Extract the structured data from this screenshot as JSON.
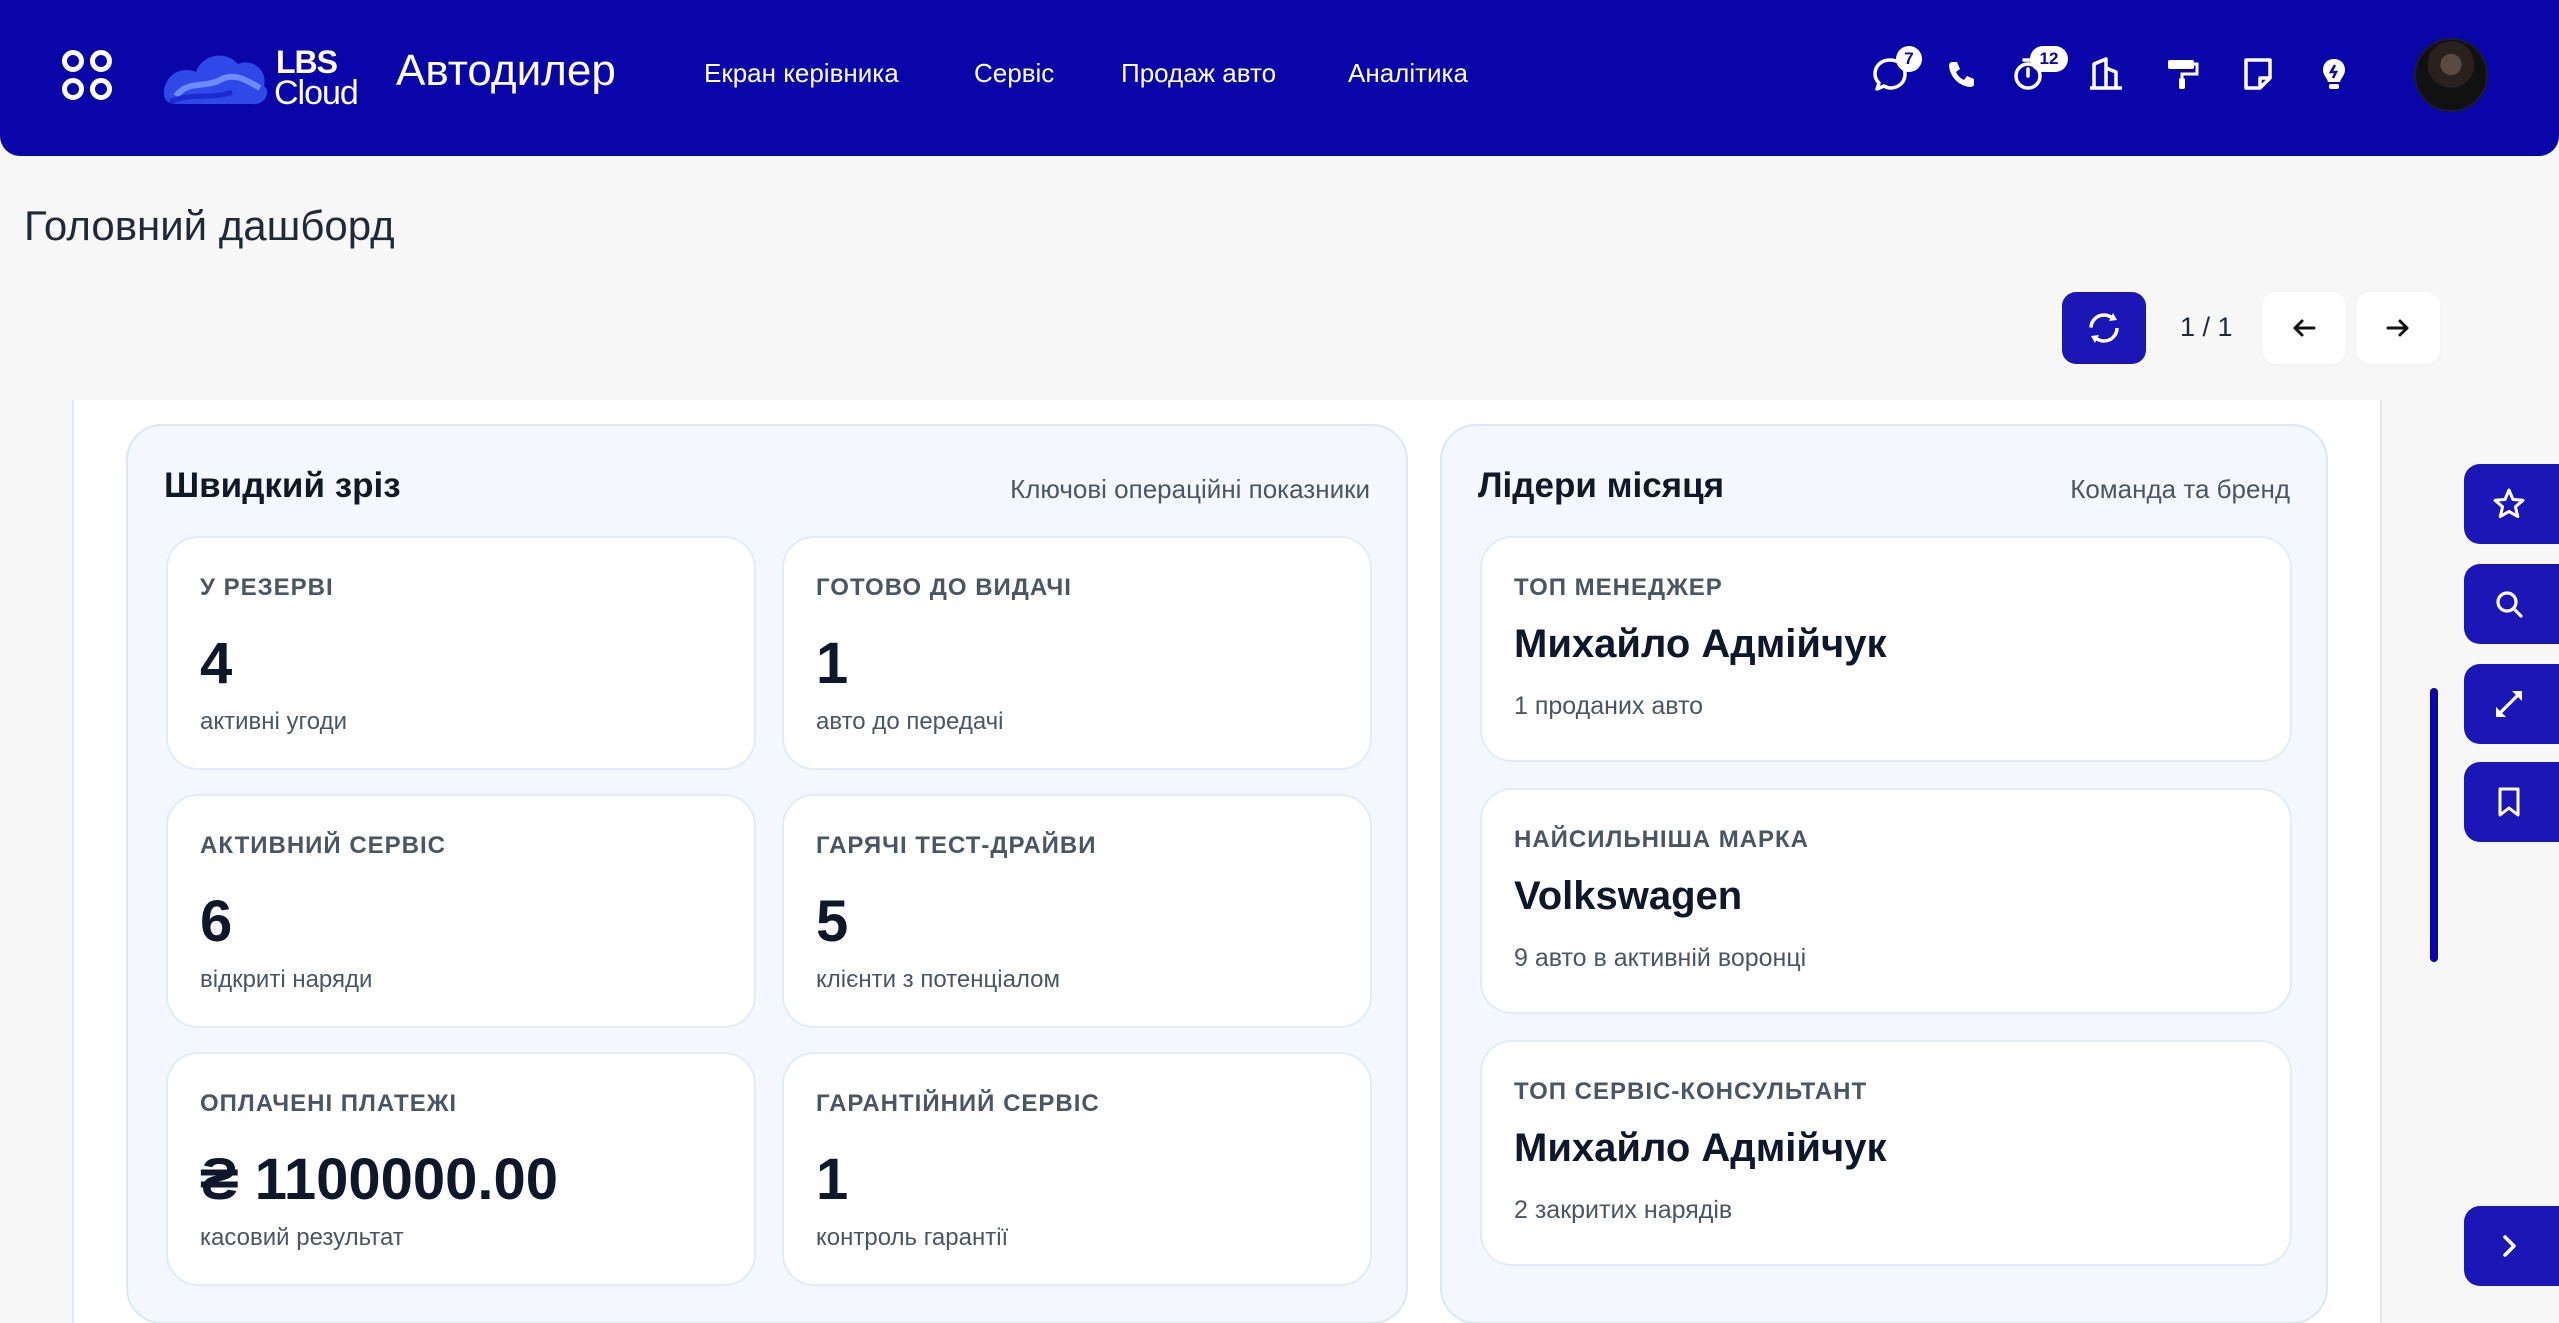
{
  "header": {
    "logo_top": "LBS",
    "logo_bottom": "Cloud",
    "app_title": "Автодилер",
    "nav": [
      "Екран керівника",
      "Сервіс",
      "Продаж авто",
      "Аналітика"
    ],
    "badges": {
      "chat": "7",
      "timer": "12"
    },
    "bg_color": "#0a05a8",
    "icons": [
      "apps-grid-icon",
      "chat-icon",
      "phone-icon",
      "timer-icon",
      "bank-icon",
      "paint-roller-icon",
      "note-icon",
      "lightbulb-icon"
    ]
  },
  "page": {
    "title": "Головний дашборд",
    "pager": "1 / 1"
  },
  "quick": {
    "title": "Швидкий зріз",
    "subtitle": "Ключові операційні показники",
    "cards": [
      {
        "label": "У РЕЗЕРВІ",
        "value": "4",
        "desc": "активні угоди"
      },
      {
        "label": "ГОТОВО ДО ВИДАЧІ",
        "value": "1",
        "desc": "авто до передачі"
      },
      {
        "label": "АКТИВНИЙ СЕРВІС",
        "value": "6",
        "desc": "відкриті наряди"
      },
      {
        "label": "ГАРЯЧІ ТЕСТ-ДРАЙВИ",
        "value": "5",
        "desc": "клієнти з потенціалом"
      },
      {
        "label": "ОПЛАЧЕНІ ПЛАТЕЖІ",
        "value": "₴ 1100000.00",
        "desc": "касовий результат"
      },
      {
        "label": "ГАРАНТІЙНИЙ СЕРВІС",
        "value": "1",
        "desc": "контроль гарантії"
      }
    ]
  },
  "leaders": {
    "title": "Лідери місяця",
    "subtitle": "Команда та бренд",
    "cards": [
      {
        "label": "ТОП МЕНЕДЖЕР",
        "value": "Михайло Адмійчук",
        "desc": "1 проданих авто"
      },
      {
        "label": "НАЙСИЛЬНІША МАРКА",
        "value": "Volkswagen",
        "desc": "9 авто в активній воронці"
      },
      {
        "label": "ТОП СЕРВІС-КОНСУЛЬТАНТ",
        "value": "Михайло Адмійчук",
        "desc": "2 закритих нарядів"
      }
    ]
  },
  "side_tools": [
    "star-icon",
    "search-icon",
    "expand-icon",
    "bookmark-icon"
  ]
}
